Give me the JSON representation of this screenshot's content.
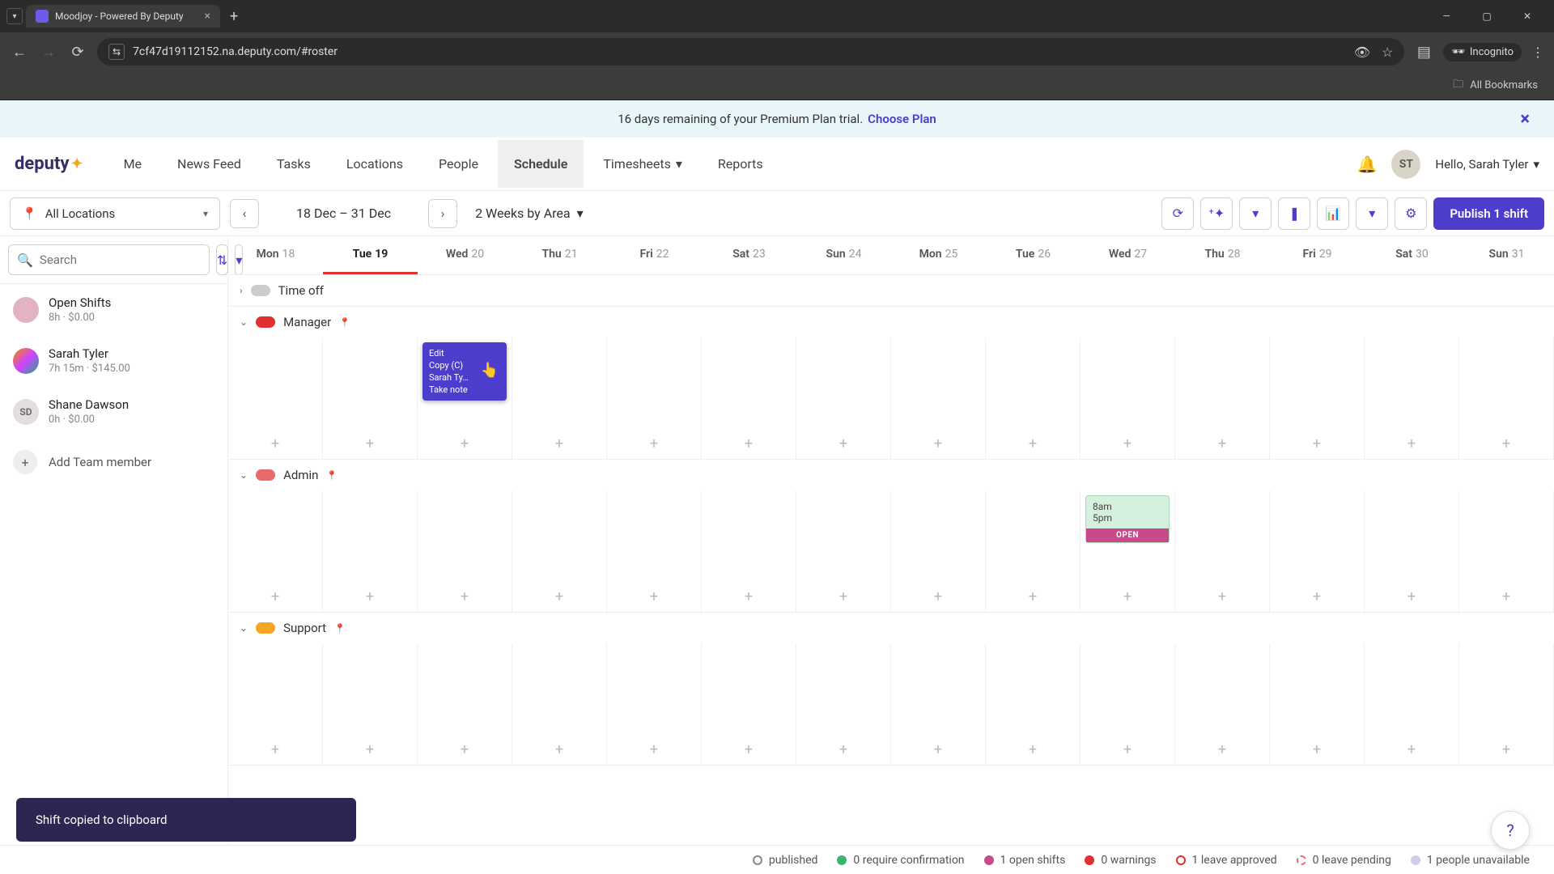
{
  "browser": {
    "tab_title": "Moodjoy - Powered By Deputy",
    "url": "7cf47d19112152.na.deputy.com/#roster",
    "incognito_label": "Incognito",
    "bookmarks_label": "All Bookmarks"
  },
  "banner": {
    "text": "16 days remaining of your Premium Plan trial.",
    "cta": "Choose Plan"
  },
  "nav": {
    "logo": "deputy",
    "items": [
      "Me",
      "News Feed",
      "Tasks",
      "Locations",
      "People",
      "Schedule",
      "Timesheets",
      "Reports"
    ],
    "active_index": 5,
    "timesheets_index": 6,
    "greeting": "Hello, Sarah Tyler",
    "avatar_initials": "ST"
  },
  "toolbar": {
    "location_label": "All Locations",
    "date_range": "18 Dec – 31 Dec",
    "view_label": "2 Weeks by Area",
    "publish_label": "Publish 1 shift"
  },
  "sidebar": {
    "search_placeholder": "Search",
    "members": [
      {
        "name": "Open Shifts",
        "meta": "8h · $0.00",
        "avatar": "",
        "avatar_cls": "pink"
      },
      {
        "name": "Sarah Tyler",
        "meta": "7h 15m · $145.00",
        "avatar": "",
        "avatar_cls": "color"
      },
      {
        "name": "Shane Dawson",
        "meta": "0h · $0.00",
        "avatar": "SD",
        "avatar_cls": ""
      }
    ],
    "add_label": "Add Team member"
  },
  "calendar": {
    "days": [
      {
        "dow": "Mon",
        "num": "18"
      },
      {
        "dow": "Tue",
        "num": "19"
      },
      {
        "dow": "Wed",
        "num": "20"
      },
      {
        "dow": "Thu",
        "num": "21"
      },
      {
        "dow": "Fri",
        "num": "22"
      },
      {
        "dow": "Sat",
        "num": "23"
      },
      {
        "dow": "Sun",
        "num": "24"
      },
      {
        "dow": "Mon",
        "num": "25"
      },
      {
        "dow": "Tue",
        "num": "26"
      },
      {
        "dow": "Wed",
        "num": "27"
      },
      {
        "dow": "Thu",
        "num": "28"
      },
      {
        "dow": "Fri",
        "num": "29"
      },
      {
        "dow": "Sat",
        "num": "30"
      },
      {
        "dow": "Sun",
        "num": "31"
      }
    ],
    "active_day_index": 1,
    "areas": [
      {
        "name": "Time off",
        "color": "grey",
        "collapsed": true
      },
      {
        "name": "Manager",
        "color": "red",
        "collapsed": false
      },
      {
        "name": "Admin",
        "color": "pink",
        "collapsed": false
      },
      {
        "name": "Support",
        "color": "orange",
        "collapsed": false
      }
    ],
    "manager_shift": {
      "day_index": 2,
      "menu": [
        "Edit",
        "Copy (C)",
        "Sarah Ty…",
        "Take note"
      ]
    },
    "admin_shift": {
      "day_index": 9,
      "start": "8am",
      "end": "5pm",
      "footer": "OPEN"
    }
  },
  "legend": {
    "items": [
      {
        "label": "published",
        "color": "#fff",
        "border": "#888"
      },
      {
        "label": "0 require confirmation",
        "color": "#3cb371"
      },
      {
        "label": "1 open shifts",
        "color": "#c84a8a"
      },
      {
        "label": "0 warnings",
        "color": "#e03030"
      },
      {
        "label": "1 leave approved",
        "color": "#fff",
        "border": "#e03030"
      },
      {
        "label": "0 leave pending",
        "color": "#fff",
        "border": "#e86a6a",
        "dashed": true
      },
      {
        "label": "1 people unavailable",
        "color": "#d0cce8"
      }
    ]
  },
  "toast": {
    "text": "Shift copied to clipboard"
  }
}
